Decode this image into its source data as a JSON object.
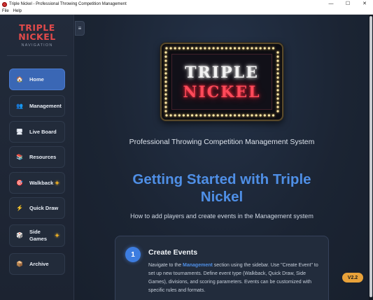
{
  "window": {
    "title": "Triple Nickel - Professional Throwing Competition Management",
    "controls": [
      "—",
      "☐",
      "✕"
    ]
  },
  "menu": [
    "File",
    "Help"
  ],
  "sidebar": {
    "logo": {
      "line1": "TRIPLE",
      "line2": "NICKEL",
      "line3": "NAVIGATION"
    },
    "items": [
      {
        "label": "Home",
        "icon": "home-icon",
        "glyph": "🏠",
        "active": true,
        "starred": false
      },
      {
        "label": "Management",
        "icon": "users-icon",
        "glyph": "👥",
        "active": false,
        "starred": false
      },
      {
        "label": "Live Board",
        "icon": "monitor-icon",
        "glyph": "🖥",
        "active": false,
        "starred": false
      },
      {
        "label": "Resources",
        "icon": "books-icon",
        "glyph": "📚",
        "active": false,
        "starred": false
      },
      {
        "label": "Walkback",
        "icon": "target-icon",
        "glyph": "🎯",
        "active": false,
        "starred": true
      },
      {
        "label": "Quick Draw",
        "icon": "lightning-icon",
        "glyph": "⚡",
        "active": false,
        "starred": false
      },
      {
        "label": "Side Games",
        "line1": "Side",
        "line2": "Games",
        "icon": "dice-icon",
        "glyph": "🎲",
        "active": false,
        "starred": true
      },
      {
        "label": "Archive",
        "icon": "archive-box-icon",
        "glyph": "📦",
        "active": false,
        "starred": false
      }
    ],
    "toggle_glyph": "≡"
  },
  "marquee": {
    "line1": "TRIPLE",
    "line2": "NICKEL"
  },
  "main": {
    "subtitle": "Professional Throwing Competition Management System",
    "heading": "Getting Started with Triple Nickel",
    "lead": "How to add players and create events in the Management system",
    "step": {
      "number": "1",
      "title": "Create Events",
      "body_prefix": "Navigate to the ",
      "body_link": "Management",
      "body_suffix": " section using the sidebar. Use \"Create Event\" to set up new tournaments. Define event type (Walkback, Quick Draw, Side Games), divisions, and scoring parameters. Events can be customized with specific rules and formats."
    }
  },
  "version_badge": "V2.2",
  "colors": {
    "accent": "#4f8fe6",
    "brand_red": "#e24a4a",
    "badge": "#e8a23a",
    "active_nav": "#3a67b5"
  }
}
